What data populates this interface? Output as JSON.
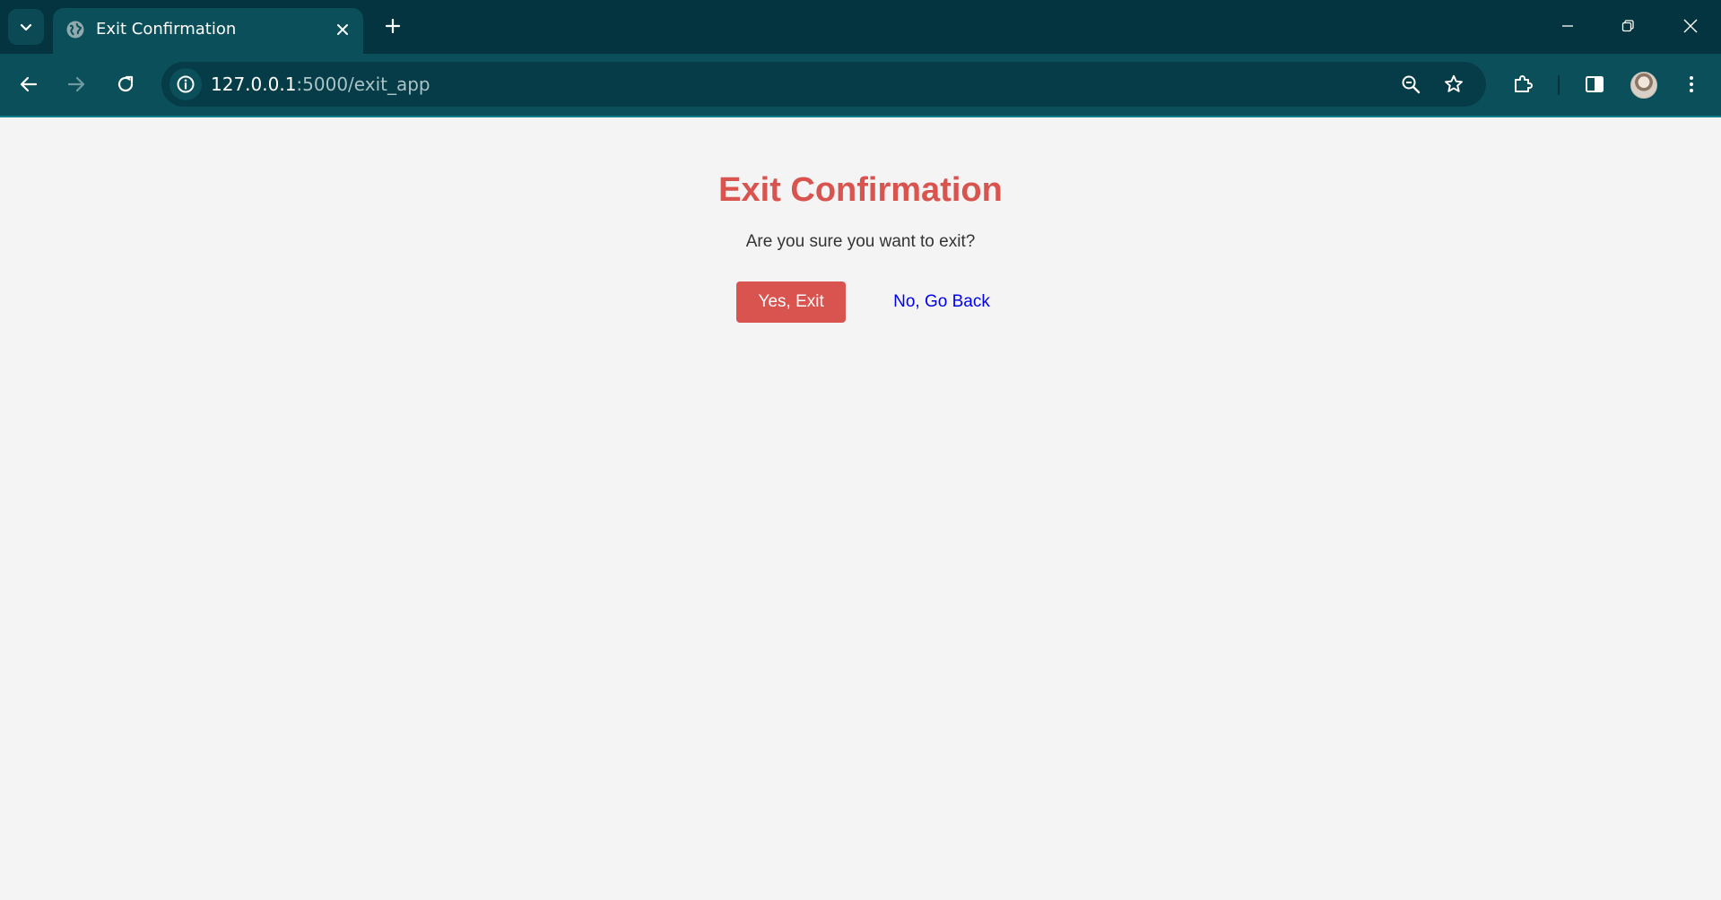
{
  "browser": {
    "tab": {
      "title": "Exit Confirmation"
    },
    "address_bar": {
      "host": "127.0.0.1",
      "path": ":5000/exit_app"
    },
    "icons": {
      "tab_search": "chevron-down-icon",
      "favicon": "globe-icon",
      "tab_close": "close-icon",
      "new_tab": "plus-icon",
      "minimize": "minimize-icon",
      "restore": "restore-icon",
      "window_close": "close-icon",
      "back": "arrow-left-icon",
      "forward": "arrow-right-icon",
      "reload": "reload-icon",
      "site_info": "info-icon",
      "zoom": "zoom-out-icon",
      "bookmark": "star-icon",
      "extensions": "puzzle-icon",
      "side_panel": "side-panel-icon",
      "profile": "avatar",
      "menu": "kebab-menu-icon"
    },
    "colors": {
      "tabstrip": "#03343f",
      "toolbar": "#0b4f5a",
      "omnibox": "#063c47"
    }
  },
  "page": {
    "title": "Exit Confirmation",
    "question": "Are you sure you want to exit?",
    "confirm_label": "Yes, Exit",
    "cancel_label": "No, Go Back",
    "colors": {
      "accent": "#d9534f",
      "link": "#0000ee",
      "background": "#f4f4f4",
      "text": "#333333"
    }
  }
}
